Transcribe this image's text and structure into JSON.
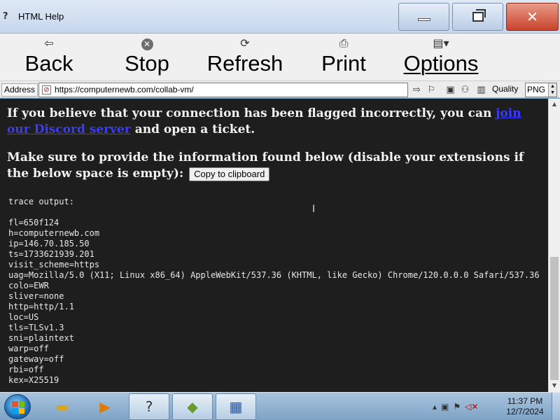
{
  "window": {
    "title": "HTML Help",
    "icon": "help-icon"
  },
  "toolbar": {
    "back_label": "Back",
    "stop_label": "Stop",
    "refresh_label": "Refresh",
    "print_label": "Print",
    "options_label": "Options"
  },
  "addressbar": {
    "label": "Address",
    "url": "https://computernewb.com/collab-vm/",
    "quality_label": "Quality",
    "quality_value": "PNG"
  },
  "page": {
    "p1_text": "If you believe that your connection has been flagged incorrectly, you can ",
    "p1_link": "join our Discord server",
    "p1_tail": " and open a ticket.",
    "p2_text": "Make sure to provide the information found below (disable your extensions if the below space is empty): ",
    "copy_button": "Copy to clipboard",
    "trace_header": "trace output:",
    "trace_lines": [
      "fl=650f124",
      "h=computernewb.com",
      "ip=146.70.185.50",
      "ts=1733621939.201",
      "visit_scheme=https",
      "uag=Mozilla/5.0 (X11; Linux x86_64) AppleWebKit/537.36 (KHTML, like Gecko) Chrome/120.0.0.0 Safari/537.36",
      "colo=EWR",
      "sliver=none",
      "http=http/1.1",
      "loc=US",
      "tls=TLSv1.3",
      "sni=plaintext",
      "warp=off",
      "gateway=off",
      "rbi=off",
      "kex=X25519"
    ]
  },
  "taskbar": {
    "clock_time": "11:37 PM",
    "clock_date": "12/7/2024"
  }
}
